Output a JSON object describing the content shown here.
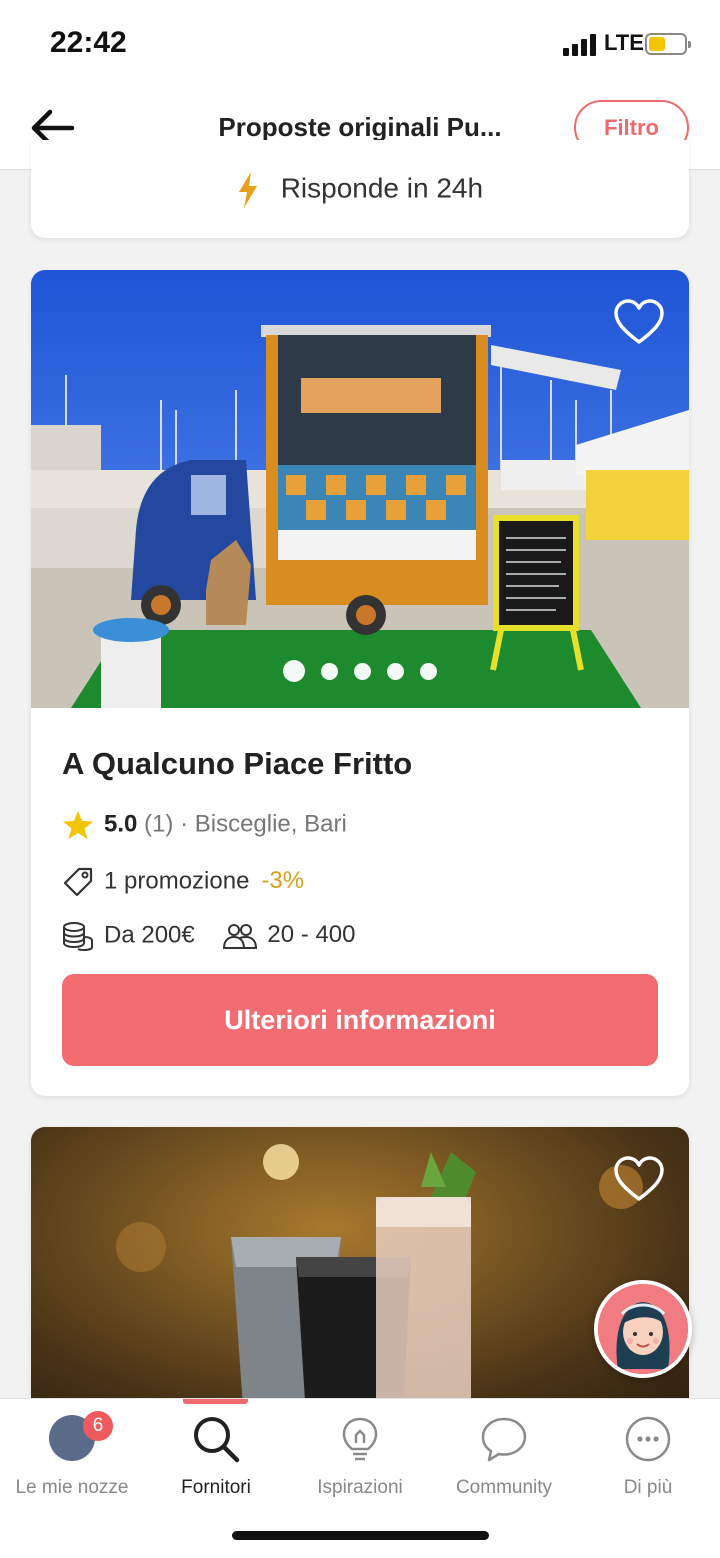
{
  "status_bar": {
    "time": "22:42",
    "network": "LTE"
  },
  "header": {
    "title": "Proposte originali Pu...",
    "filter_label": "Filtro"
  },
  "previous_card": {
    "response_text": "Risponde in 24h"
  },
  "vendor_card": {
    "name": "A Qualcuno Piace Fritto",
    "rating": "5.0",
    "review_count": "(1)",
    "location": "· Bisceglie, Bari",
    "promotion_text": "1 promozione",
    "promotion_discount": "-3%",
    "price": "Da 200€",
    "guests": "20 - 400",
    "cta_label": "Ulteriori informazioni",
    "photo_count": 5,
    "active_photo": 1,
    "favorited": false
  },
  "bottom_nav": {
    "items": [
      {
        "label": "Le mie nozze",
        "icon": "avatar-icon",
        "badge": "6"
      },
      {
        "label": "Fornitori",
        "icon": "search-icon",
        "active": true
      },
      {
        "label": "Ispirazioni",
        "icon": "lightbulb-icon"
      },
      {
        "label": "Community",
        "icon": "chat-bubble-icon"
      },
      {
        "label": "Di più",
        "icon": "more-icon"
      }
    ]
  },
  "colors": {
    "accent": "#ef6a6f",
    "cta": "#f26d72",
    "discount": "#d4a017",
    "star": "#f5c400",
    "bolt": "#e5a11a"
  }
}
